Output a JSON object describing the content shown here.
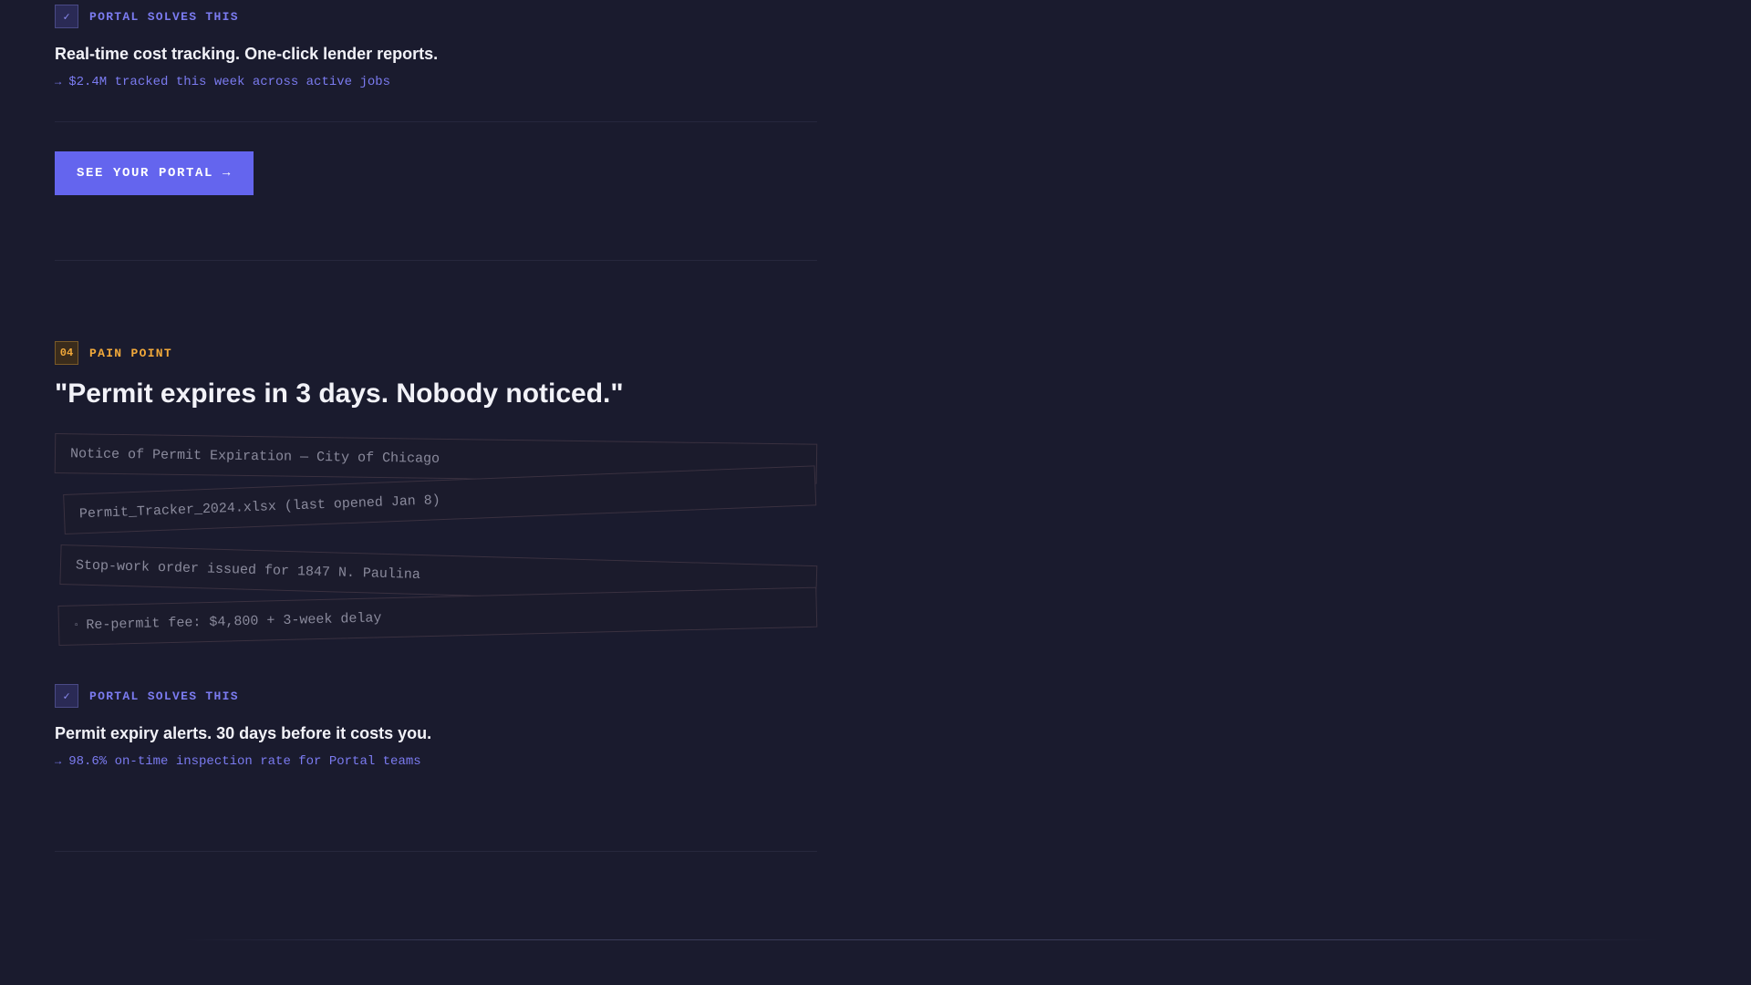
{
  "solve_block_1": {
    "badge_icon": "check-icon",
    "badge_glyph": "✓",
    "label": "PORTAL SOLVES THIS",
    "title": "Real-time cost tracking. One-click lender reports.",
    "stat_arrow": "→",
    "stat": "$2.4M tracked this week across active jobs"
  },
  "cta": {
    "label": "SEE YOUR PORTAL →"
  },
  "pain_block": {
    "number": "04",
    "label": "PAIN POINT",
    "title": "\"Permit expires in 3 days. Nobody noticed.\"",
    "documents": [
      "Notice of Permit Expiration — City of Chicago",
      "Permit_Tracker_2024.xlsx (last opened Jan 8)",
      "Stop-work order issued for 1847 N. Paulina",
      "Re-permit fee: $4,800 + 3-week delay"
    ],
    "doc_bullet": "▫"
  },
  "solve_block_2": {
    "badge_icon": "check-icon",
    "badge_glyph": "✓",
    "label": "PORTAL SOLVES THIS",
    "title": "Permit expiry alerts. 30 days before it costs you.",
    "stat_arrow": "→",
    "stat": "98.6% on-time inspection rate for Portal teams"
  },
  "colors": {
    "background": "#1a1b2e",
    "accent": "#6465ee",
    "pain_accent": "#f2a93a"
  }
}
